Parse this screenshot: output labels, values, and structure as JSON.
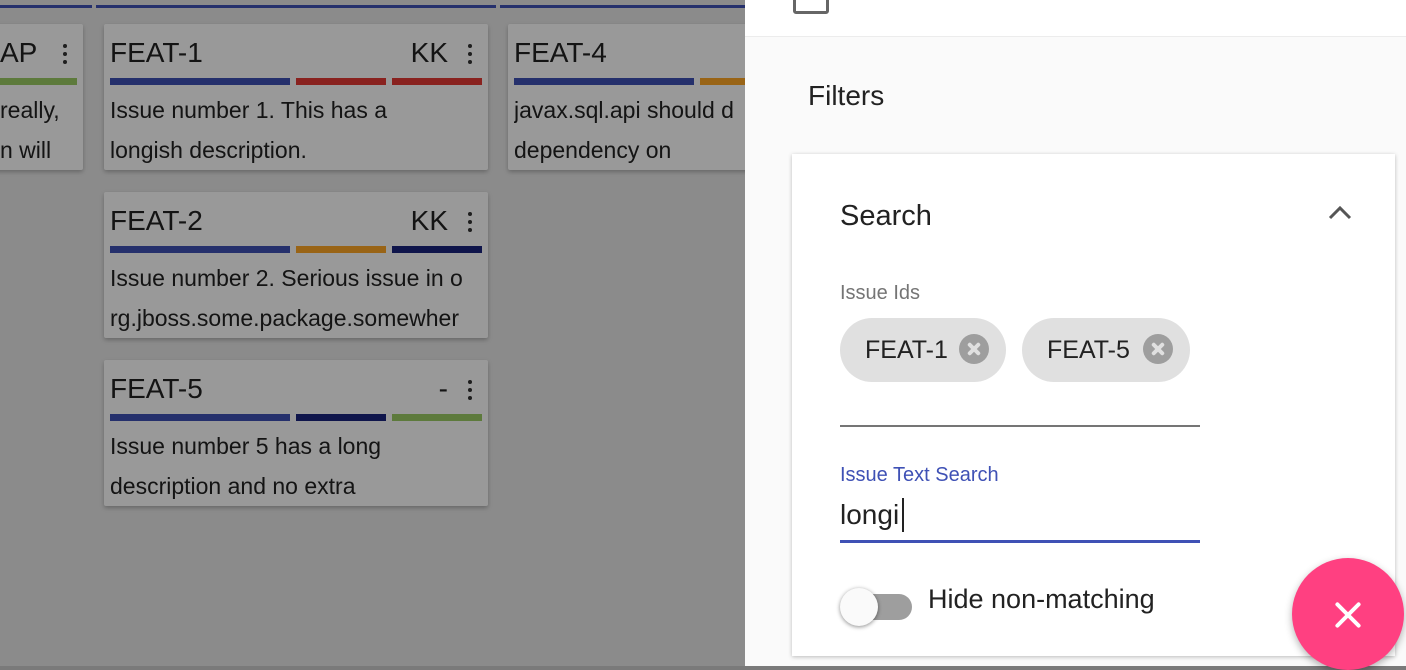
{
  "board": {
    "cards": [
      {
        "id": "AP",
        "assignee": "",
        "desc_line1": "really,",
        "desc_line2": "n will",
        "bars": [
          "#9ccc65"
        ]
      },
      {
        "id": "FEAT-1",
        "assignee": "KK",
        "desc_line1": "Issue number 1. This has a",
        "desc_line2": "longish description.",
        "bars": [
          "#3f51b5",
          "#e53935",
          "#e53935"
        ]
      },
      {
        "id": "FEAT-4",
        "assignee": "",
        "desc_line1": "javax.sql.api should d",
        "desc_line2": "dependency on",
        "bars": [
          "#3f51b5",
          "#ffa726"
        ]
      },
      {
        "id": "FEAT-2",
        "assignee": "KK",
        "desc_line1": "Issue number 2. Serious issue in o",
        "desc_line2": "rg.jboss.some.package.somewher",
        "bars": [
          "#3f51b5",
          "#ffa726",
          "#1a237e"
        ]
      },
      {
        "id": "FEAT-5",
        "assignee": "-",
        "desc_line1": "Issue number 5 has a long",
        "desc_line2": "description and no extra",
        "bars": [
          "#3f51b5",
          "#1a237e",
          "#9ccc65"
        ]
      }
    ]
  },
  "panel": {
    "filters_title": "Filters",
    "search": {
      "title": "Search",
      "issue_ids_label": "Issue Ids",
      "chips": [
        "FEAT-1",
        "FEAT-5"
      ],
      "text_search_label": "Issue Text Search",
      "text_search_value": "longi",
      "hide_non_matching_label": "Hide non-matching",
      "hide_non_matching_on": false
    }
  },
  "colors": {
    "accent": "#3f51b5",
    "fab": "#ff4081"
  }
}
